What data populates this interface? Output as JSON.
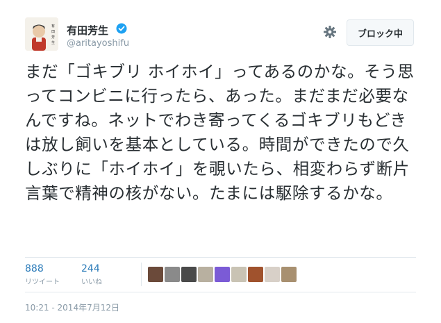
{
  "user": {
    "display_name": "有田芳生",
    "screen_name": "@aritayoshifu",
    "verified_color": "#1da1f2"
  },
  "actions": {
    "settings_icon": "gear-icon",
    "block_label": "ブロック中"
  },
  "tweet": {
    "text": "まだ「ゴキブリ ホイホイ」ってあるのかな。そう思ってコンビニに行ったら、あった。まだまだ必要なんですね。ネットでわき寄ってくるゴキブリもどきは放し飼いを基本としている。時間ができたので久しぶりに「ホイホイ」を覗いたら、相変わらず断片言葉で精神の核がない。たまには駆除するかな。"
  },
  "stats": {
    "retweets": {
      "count": "888",
      "label": "リツイート"
    },
    "likes": {
      "count": "244",
      "label": "いいね"
    }
  },
  "likers": [
    {
      "name": "liker-avatar-1",
      "color": "#6b4a3a"
    },
    {
      "name": "liker-avatar-2",
      "color": "#8a8a8a"
    },
    {
      "name": "liker-avatar-3",
      "color": "#4a4a4a"
    },
    {
      "name": "liker-avatar-4",
      "color": "#b8b0a0"
    },
    {
      "name": "liker-avatar-5",
      "color": "#7b5bd6"
    },
    {
      "name": "liker-avatar-6",
      "color": "#c9c3b4"
    },
    {
      "name": "liker-avatar-7",
      "color": "#a0522d"
    },
    {
      "name": "liker-avatar-8",
      "color": "#d8d0c8"
    },
    {
      "name": "liker-avatar-9",
      "color": "#a89070"
    }
  ],
  "timestamp": "10:21 - 2014年7月12日",
  "colors": {
    "link": "#2b7bb9",
    "muted": "#8899a6",
    "border": "#e1e8ed"
  }
}
